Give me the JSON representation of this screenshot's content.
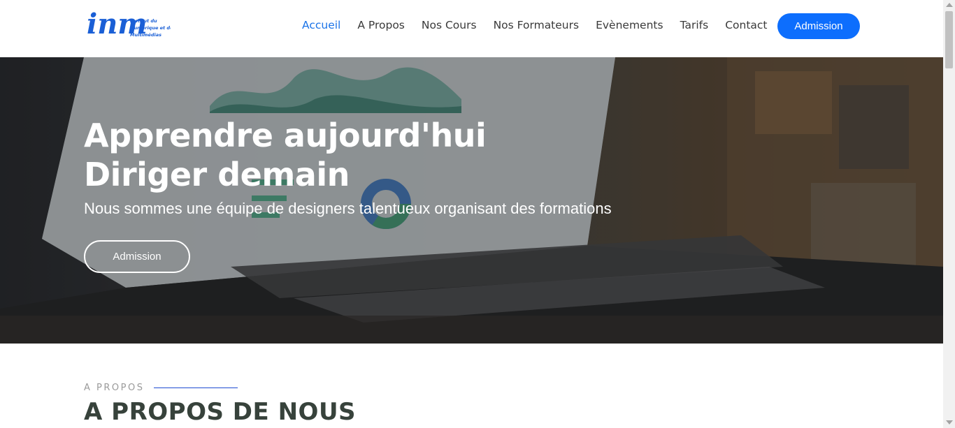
{
  "brand": {
    "logo_mark": "inm",
    "logo_text_line1": "Institut du",
    "logo_text_line2": "Numérique et des",
    "logo_text_line3": "Multimédias",
    "accent_color": "#0d6efd"
  },
  "nav": {
    "items": [
      {
        "label": "Accueil",
        "active": true
      },
      {
        "label": "A Propos",
        "active": false
      },
      {
        "label": "Nos Cours",
        "active": false
      },
      {
        "label": "Nos Formateurs",
        "active": false
      },
      {
        "label": "Evènements",
        "active": false
      },
      {
        "label": "Tarifs",
        "active": false
      },
      {
        "label": "Contact",
        "active": false
      }
    ],
    "cta_label": "Admission"
  },
  "hero": {
    "title_line1": "Apprendre aujourd'hui",
    "title_line2": "Diriger demain",
    "subtitle": "Nous sommes une équipe de designers talentueux organisant des formations",
    "button_label": "Admission",
    "background_image": "laptop-dashboard-photo"
  },
  "about": {
    "kicker": "A PROPOS",
    "title": "A PROPOS DE NOUS"
  }
}
